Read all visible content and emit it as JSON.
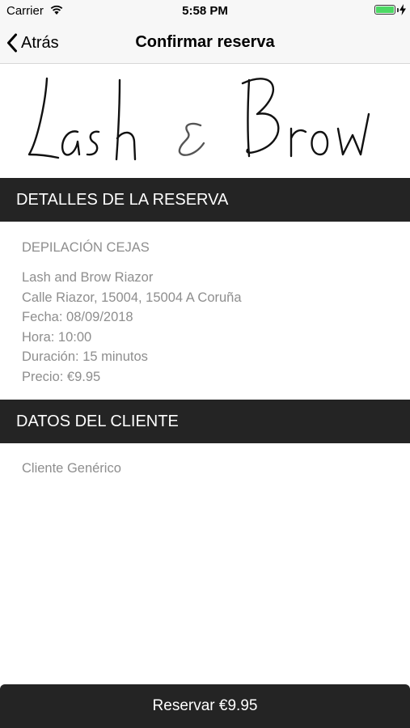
{
  "status_bar": {
    "carrier": "Carrier",
    "time": "5:58 PM",
    "battery_level": 1.0
  },
  "nav": {
    "back_label": "Atrás",
    "title": "Confirmar reserva"
  },
  "logo": {
    "text": "Lash & Brow"
  },
  "booking_details": {
    "header": "DETALLES DE LA RESERVA",
    "service": "DEPILACIÓN CEJAS",
    "salon": "Lash and Brow Riazor",
    "address": "Calle Riazor, 15004, 15004 A Coruña",
    "date": "Fecha: 08/09/2018",
    "time": "Hora: 10:00",
    "duration": "Duración: 15 minutos",
    "price": "Precio: €9.95"
  },
  "client": {
    "header": "DATOS DEL CLIENTE",
    "name": "Cliente Genérico"
  },
  "action": {
    "reserve_label": "Reservar €9.95"
  },
  "colors": {
    "header_bg": "#242424",
    "detail_text": "#8e8e8e",
    "battery": "#4cd964",
    "nav_bg": "#f7f7f7"
  },
  "icons": [
    "wifi-icon",
    "battery-icon",
    "charging-bolt-icon",
    "back-chevron-icon"
  ]
}
